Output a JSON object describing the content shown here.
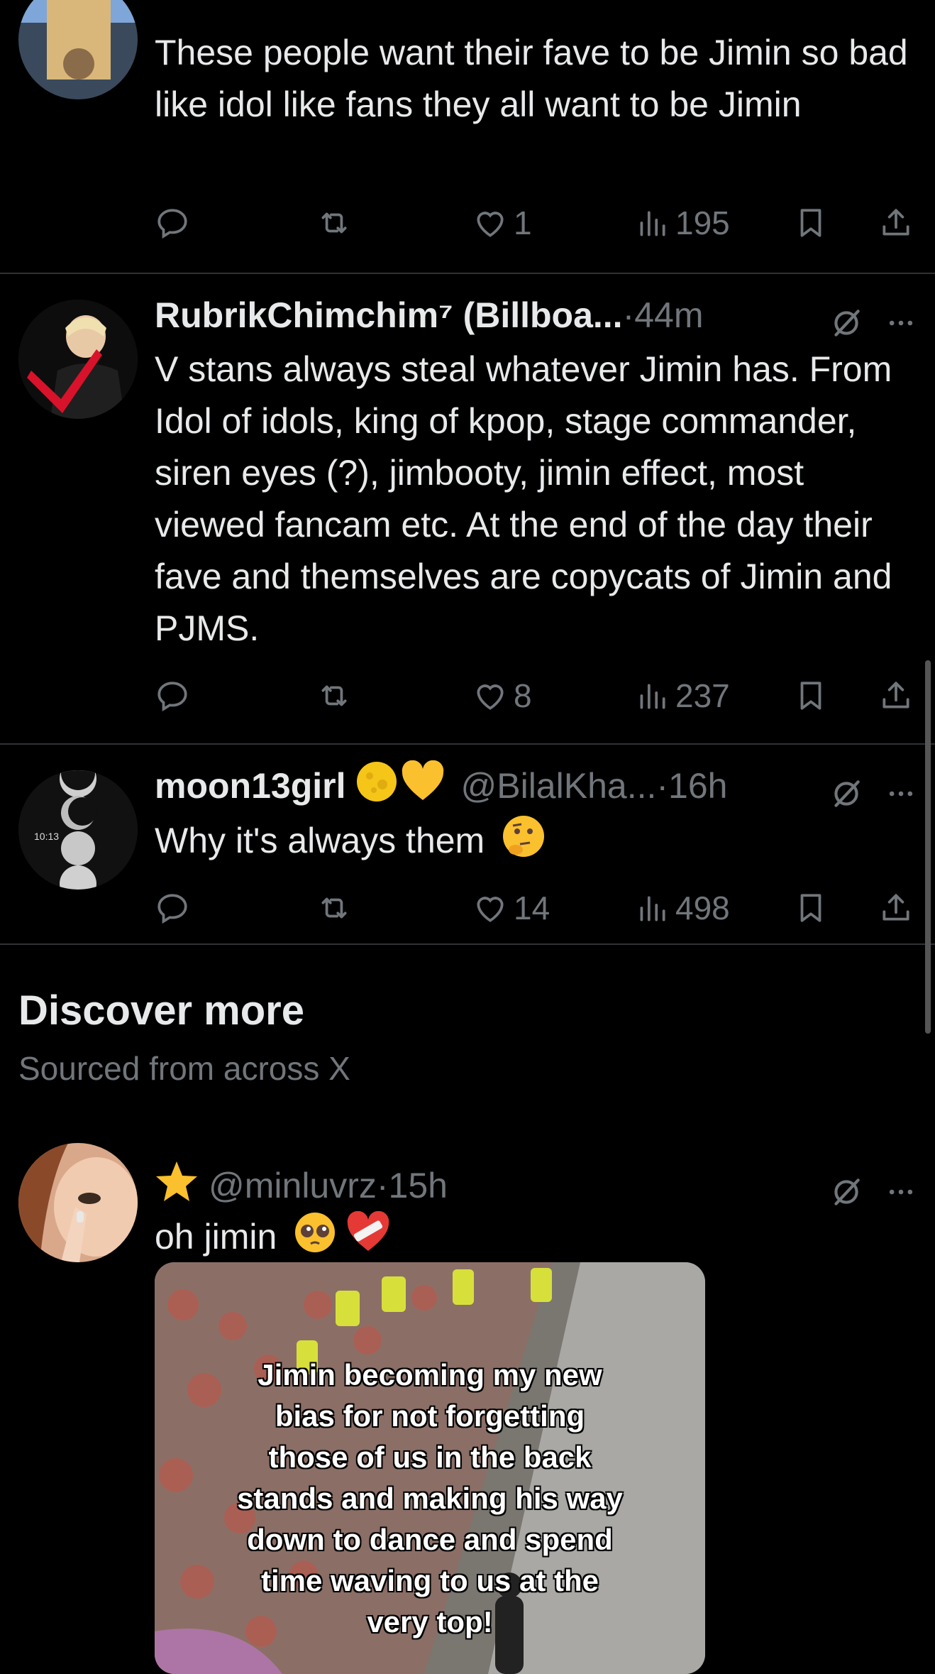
{
  "tweets": [
    {
      "body": "These people want their fave to be Jimin so bad like idol like fans they all want to be Jimin",
      "likes": "1",
      "views": "195"
    },
    {
      "name": "RubrikChimchim⁷ (Billboa...",
      "time": "·44m",
      "body": "V stans always steal whatever Jimin has. From Idol of idols, king of kpop, stage commander, siren eyes (?), jimbooty, jimin effect, most viewed fancam etc. At the end of the day their fave and themselves are copycats of Jimin and PJMS.",
      "likes": "8",
      "views": "237"
    },
    {
      "name": "moon13girl",
      "handle": "@BilalKha...",
      "time": "·16h",
      "body": "Why it's always them",
      "avatar_text": "10:13",
      "likes": "14",
      "views": "498"
    }
  ],
  "discover": {
    "title": "Discover more",
    "subtitle": "Sourced from across X"
  },
  "discover_tweet": {
    "handle": "@minluvrz",
    "time": "·15h",
    "body": "oh jimin",
    "media_caption": "Jimin becoming my new\nbias for not forgetting\nthose of us in the back\nstands and making his way\ndown to dance and spend\ntime waving to us at the\nvery top!"
  },
  "icons": {
    "reply": "reply-icon",
    "retweet": "retweet-icon",
    "like": "heart-icon",
    "views": "views-icon",
    "bookmark": "bookmark-icon",
    "share": "share-icon",
    "grok": "grok-icon",
    "more": "more-icon"
  },
  "colors": {
    "background": "#000000",
    "text": "#e7e9ea",
    "muted": "#71767b",
    "divider": "#2f3336"
  }
}
